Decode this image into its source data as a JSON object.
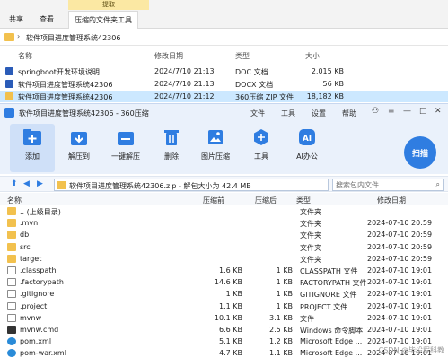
{
  "explorer": {
    "context_tab": "提取",
    "tabs": [
      "共享",
      "查看",
      "压缩的文件夹工具"
    ],
    "address": "软件项目进度管理系统42306",
    "columns": [
      "名称",
      "修改日期",
      "类型",
      "大小"
    ],
    "files": [
      {
        "name": "springboot开发环境说明",
        "date": "2024/7/10 21:13",
        "type": "DOC 文档",
        "size": "2,015 KB"
      },
      {
        "name": "软件项目进度管理系统42306",
        "date": "2024/7/10 21:13",
        "type": "DOCX 文档",
        "size": "56 KB"
      },
      {
        "name": "软件项目进度管理系统42306",
        "date": "2024/7/10 21:12",
        "type": "360压缩 ZIP 文件",
        "size": "18,182 KB"
      }
    ]
  },
  "zipwin": {
    "title": "软件项目进度管理系统42306 - 360压缩",
    "menus": [
      "文件",
      "工具",
      "设置",
      "帮助"
    ],
    "controls": {
      "skin": "⚇",
      "menu": "≡",
      "min": "—",
      "max": "□",
      "close": "✕"
    },
    "toolbar": [
      {
        "label": "添加",
        "icon": "add-icon"
      },
      {
        "label": "解压到",
        "icon": "extract-to-icon"
      },
      {
        "label": "一键解压",
        "icon": "one-click-extract-icon"
      },
      {
        "label": "删除",
        "icon": "delete-icon"
      },
      {
        "label": "图片压缩",
        "icon": "image-compress-icon"
      },
      {
        "label": "工具",
        "icon": "tools-icon"
      },
      {
        "label": "AI办公",
        "icon": "ai-office-icon"
      }
    ],
    "scan_label": "扫描",
    "path": "软件项目进度管理系统42306.zip - 解包大小为 42.4 MB",
    "search_placeholder": "搜索包内文件",
    "columns": [
      "名称",
      "压缩前",
      "压缩后",
      "类型",
      "修改日期"
    ],
    "rows": [
      {
        "name": ".. (上级目录)",
        "before": "",
        "after": "",
        "type": "文件夹",
        "date": "",
        "icon": "folder"
      },
      {
        "name": ".mvn",
        "before": "",
        "after": "",
        "type": "文件夹",
        "date": "2024-07-10 20:59",
        "icon": "folder"
      },
      {
        "name": "db",
        "before": "",
        "after": "",
        "type": "文件夹",
        "date": "2024-07-10 20:59",
        "icon": "folder"
      },
      {
        "name": "src",
        "before": "",
        "after": "",
        "type": "文件夹",
        "date": "2024-07-10 20:59",
        "icon": "folder"
      },
      {
        "name": "target",
        "before": "",
        "after": "",
        "type": "文件夹",
        "date": "2024-07-10 20:59",
        "icon": "folder"
      },
      {
        "name": ".classpath",
        "before": "1.6 KB",
        "after": "1 KB",
        "type": "CLASSPATH 文件",
        "date": "2024-07-10 19:01",
        "icon": "file"
      },
      {
        "name": ".factorypath",
        "before": "14.6 KB",
        "after": "1 KB",
        "type": "FACTORYPATH 文件",
        "date": "2024-07-10 19:01",
        "icon": "file"
      },
      {
        "name": ".gitignore",
        "before": "1 KB",
        "after": "1 KB",
        "type": "GITIGNORE 文件",
        "date": "2024-07-10 19:01",
        "icon": "file"
      },
      {
        "name": ".project",
        "before": "1.1 KB",
        "after": "1 KB",
        "type": "PROJECT 文件",
        "date": "2024-07-10 19:01",
        "icon": "file"
      },
      {
        "name": "mvnw",
        "before": "10.1 KB",
        "after": "3.1 KB",
        "type": "文件",
        "date": "2024-07-10 19:01",
        "icon": "file"
      },
      {
        "name": "mvnw.cmd",
        "before": "6.6 KB",
        "after": "2.5 KB",
        "type": "Windows 命令脚本",
        "date": "2024-07-10 19:01",
        "icon": "cmd"
      },
      {
        "name": "pom.xml",
        "before": "5.1 KB",
        "after": "1.2 KB",
        "type": "Microsoft Edge ...",
        "date": "2024-07-10 19:01",
        "icon": "edge"
      },
      {
        "name": "pom-war.xml",
        "before": "4.7 KB",
        "after": "1.1 KB",
        "type": "Microsoft Edge ...",
        "date": "2024-07-10 19:01",
        "icon": "edge"
      }
    ]
  },
  "watermark": "CSDN @毕设程科教"
}
